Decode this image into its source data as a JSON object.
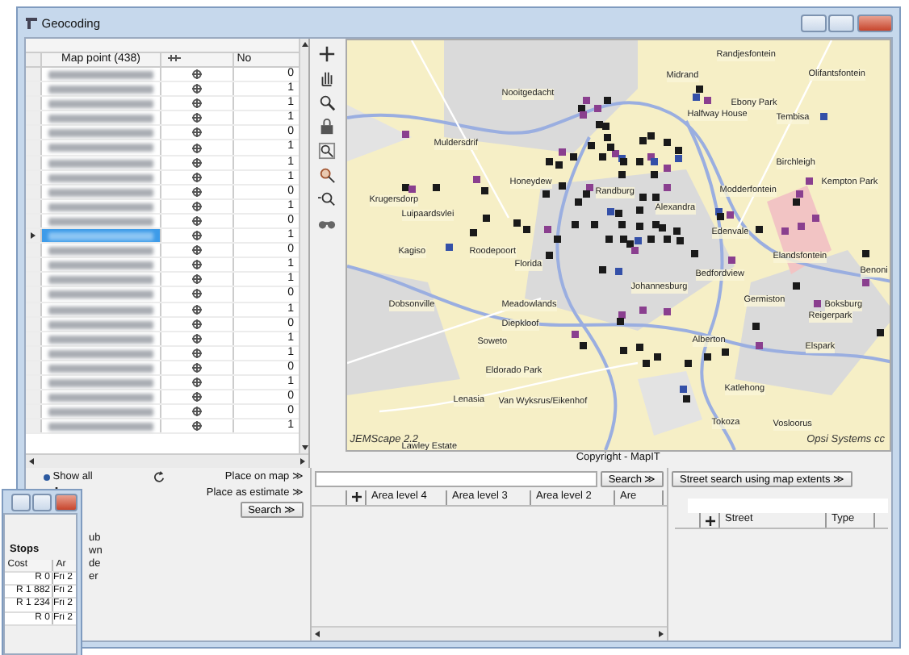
{
  "window": {
    "title": "Geocoding"
  },
  "points_table": {
    "columns": [
      "Map point (438)",
      "No"
    ],
    "rows": [
      {
        "no": "0",
        "selected": false
      },
      {
        "no": "1",
        "selected": false
      },
      {
        "no": "1",
        "selected": false
      },
      {
        "no": "1",
        "selected": false
      },
      {
        "no": "0",
        "selected": false
      },
      {
        "no": "1",
        "selected": false
      },
      {
        "no": "1",
        "selected": false
      },
      {
        "no": "1",
        "selected": false
      },
      {
        "no": "0",
        "selected": false
      },
      {
        "no": "1",
        "selected": false
      },
      {
        "no": "0",
        "selected": false
      },
      {
        "no": "1",
        "selected": true
      },
      {
        "no": "0",
        "selected": false
      },
      {
        "no": "1",
        "selected": false
      },
      {
        "no": "1",
        "selected": false
      },
      {
        "no": "0",
        "selected": false
      },
      {
        "no": "1",
        "selected": false
      },
      {
        "no": "0",
        "selected": false
      },
      {
        "no": "1",
        "selected": false
      },
      {
        "no": "1",
        "selected": false
      },
      {
        "no": "0",
        "selected": false
      },
      {
        "no": "1",
        "selected": false
      },
      {
        "no": "0",
        "selected": false
      },
      {
        "no": "0",
        "selected": false
      },
      {
        "no": "1",
        "selected": false
      }
    ]
  },
  "map": {
    "place_labels": [
      "Randjesfontein",
      "Midrand",
      "Olifantsfontein",
      "Nooitgedacht",
      "Ebony Park",
      "Halfway House",
      "Tembisa",
      "Muldersdrif",
      "Birchleigh",
      "Honeydew",
      "Modderfontein",
      "Kempton Park",
      "Randburg",
      "Krugersdorp",
      "Luipaardsvlei",
      "Alexandra",
      "Edenvale",
      "Kagiso",
      "Roodepoort",
      "Florida",
      "Bedfordview",
      "Elandsfontein",
      "Germiston",
      "Benoni",
      "Dobsonville",
      "Meadowlands",
      "Johannesburg",
      "Boksburg",
      "Reigerpark",
      "Diepkloof",
      "Soweto",
      "Alberton",
      "Elspark",
      "Eldorado Park",
      "Lenasia",
      "Van Wyksrus/Eikenhof",
      "Katlehong",
      "Tokoza",
      "Vosloorus",
      "Lawley Estate"
    ],
    "left_caption": "JEMScape 2.2",
    "right_caption": "Opsi Systems cc",
    "copyright": "Copyright - MapIT"
  },
  "point_actions": {
    "show_all": {
      "label": "Show all",
      "selected": true
    },
    "place_on_map": "Place on map ≫",
    "place_as_estimate": "Place as estimate ≫",
    "search": "Search ≫"
  },
  "area_search": {
    "button": "Search ≫",
    "columns": [
      "Area level 4",
      "Area level 3",
      "Area level 2",
      "Are"
    ]
  },
  "street_search": {
    "button": "Street search using map extents ≫",
    "columns": [
      "Street",
      "Type"
    ]
  },
  "clipped_texts": [
    "ub",
    "wn",
    "de",
    "er"
  ],
  "stops_window": {
    "title": "Stops",
    "columns": [
      "Cost",
      "Ar"
    ],
    "rows": [
      {
        "cost": "R 0",
        "arrival": "Fri 2"
      },
      {
        "cost": "R 1 882",
        "arrival": "Fri 2"
      },
      {
        "cost": "R 1 234",
        "arrival": "Fri 2"
      },
      {
        "cost": "R 0",
        "arrival": "Fri 2"
      }
    ]
  }
}
